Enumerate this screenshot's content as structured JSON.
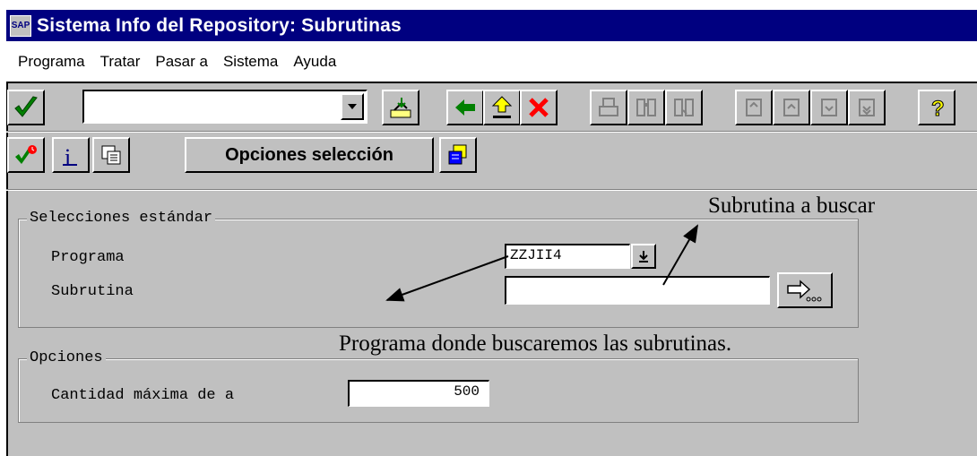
{
  "window": {
    "title": "Sistema Info del Repository: Subrutinas",
    "icon_label": "SAP"
  },
  "menu": [
    {
      "label": "Programa"
    },
    {
      "label": "Tratar"
    },
    {
      "label": "Pasar a"
    },
    {
      "label": "Sistema"
    },
    {
      "label": "Ayuda"
    }
  ],
  "toolbar": {
    "command_field_value": "",
    "icons": [
      "checkmark-icon",
      "save-icon",
      "back-icon",
      "exit-icon",
      "cancel-icon",
      "print-icon",
      "find-icon",
      "find-next-icon",
      "first-page-icon",
      "previous-page-icon",
      "next-page-icon",
      "last-page-icon",
      "help-icon"
    ]
  },
  "app_toolbar": {
    "options_button_label": "Opciones selección",
    "icons": [
      "execute-icon",
      "info-icon",
      "variants-icon",
      "dynamic-selections-icon"
    ]
  },
  "selections": {
    "group_title": "Selecciones estándar",
    "programa_label": "Programa",
    "programa_value": "ZZJII4",
    "subrutina_label": "Subrutina",
    "subrutina_value": ""
  },
  "options": {
    "group_title": "Opciones",
    "max_label": "Cantidad máxima de a",
    "max_value": "500"
  },
  "annotations": {
    "subroutine_note": "Subrutina a buscar",
    "program_note": "Programa donde buscaremos las subrutinas."
  }
}
